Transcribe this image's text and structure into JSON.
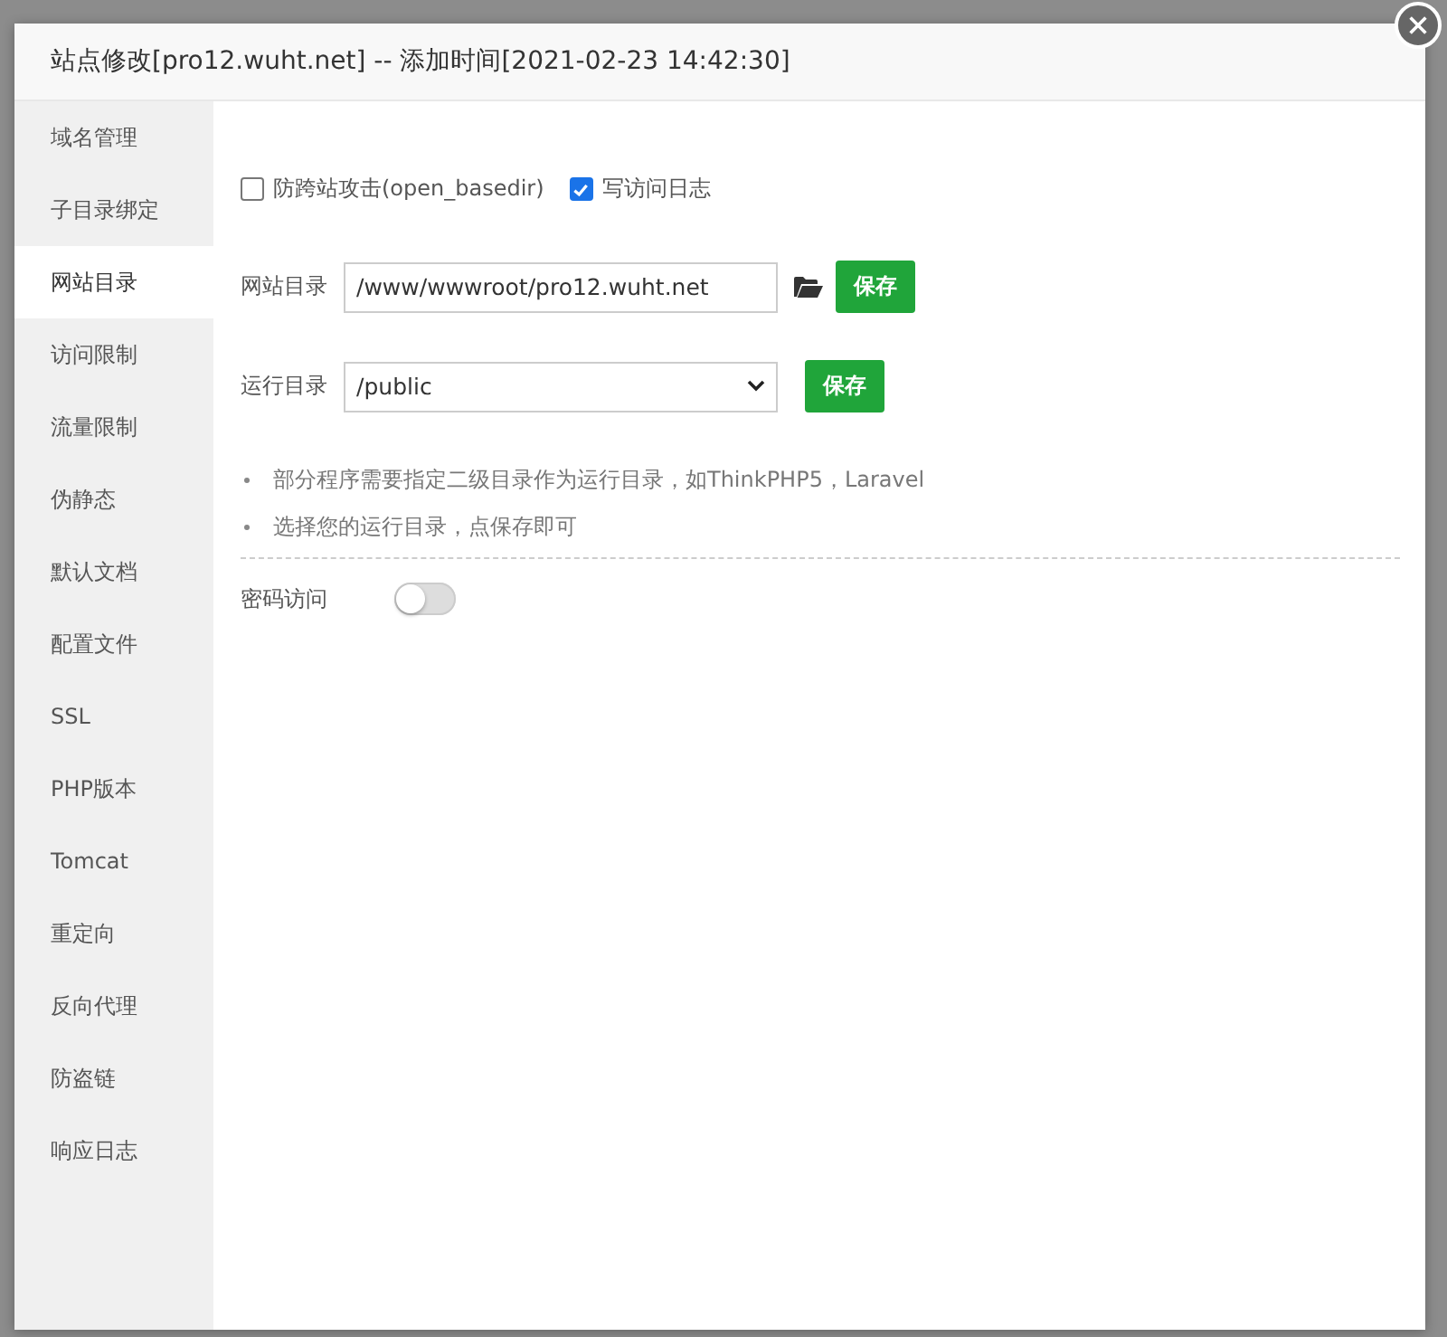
{
  "dialog": {
    "title": "站点修改[pro12.wuht.net] -- 添加时间[2021-02-23 14:42:30]"
  },
  "sidebar": {
    "items": [
      {
        "label": "域名管理",
        "selected": false
      },
      {
        "label": "子目录绑定",
        "selected": false
      },
      {
        "label": "网站目录",
        "selected": true
      },
      {
        "label": "访问限制",
        "selected": false
      },
      {
        "label": "流量限制",
        "selected": false
      },
      {
        "label": "伪静态",
        "selected": false
      },
      {
        "label": "默认文档",
        "selected": false
      },
      {
        "label": "配置文件",
        "selected": false
      },
      {
        "label": "SSL",
        "selected": false
      },
      {
        "label": "PHP版本",
        "selected": false
      },
      {
        "label": "Tomcat",
        "selected": false
      },
      {
        "label": "重定向",
        "selected": false
      },
      {
        "label": "反向代理",
        "selected": false
      },
      {
        "label": "防盗链",
        "selected": false
      },
      {
        "label": "响应日志",
        "selected": false
      }
    ]
  },
  "options": [
    {
      "label": "防跨站攻击(open_basedir)",
      "checked": false
    },
    {
      "label": "写访问日志",
      "checked": true
    }
  ],
  "site_dir": {
    "label": "网站目录",
    "value": "/www/wwwroot/pro12.wuht.net",
    "button": "保存"
  },
  "run_dir": {
    "label": "运行目录",
    "value": "/public",
    "button": "保存"
  },
  "tips": [
    "部分程序需要指定二级目录作为运行目录，如ThinkPHP5，Laravel",
    "选择您的运行目录，点保存即可"
  ],
  "password_access": {
    "label": "密码访问",
    "on": false
  }
}
